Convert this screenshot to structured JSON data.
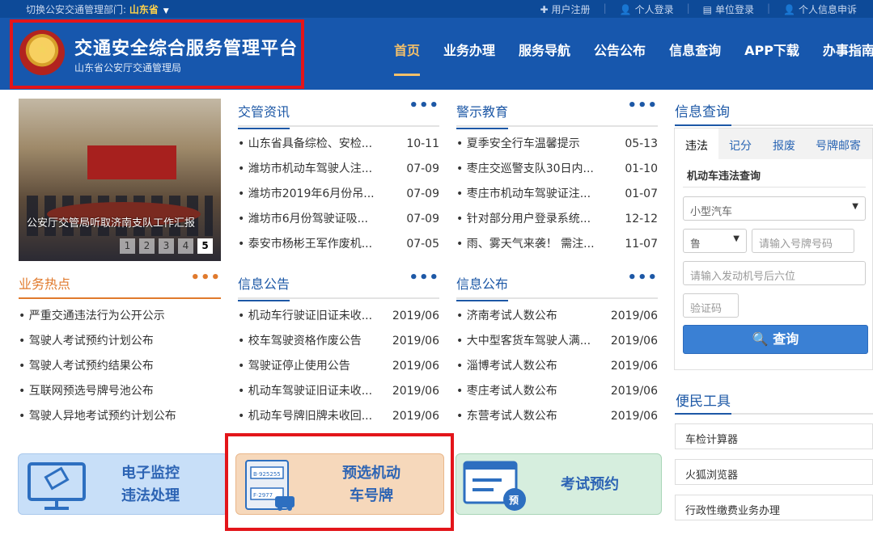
{
  "topbar": {
    "switch_label": "切换公安交通管理部门:",
    "province": "山东省",
    "links": [
      {
        "icon": "plus-icon",
        "label": "用户注册"
      },
      {
        "icon": "user-icon",
        "label": "个人登录"
      },
      {
        "icon": "building-icon",
        "label": "单位登录"
      },
      {
        "icon": "user-icon",
        "label": "个人信息申诉"
      }
    ]
  },
  "header": {
    "title": "交通安全综合服务管理平台",
    "subtitle": "山东省公安厅交通管理局",
    "nav": [
      "首页",
      "业务办理",
      "服务导航",
      "公告公布",
      "信息查询",
      "APP下载",
      "办事指南"
    ]
  },
  "slider": {
    "caption": "公安厅交管局听取济南支队工作汇报",
    "pages": [
      "1",
      "2",
      "3",
      "4",
      "5"
    ],
    "active_page": "5"
  },
  "news": {
    "title": "交管资讯",
    "more": "•••",
    "items": [
      {
        "text": "山东省具备综检、安检...",
        "date": "10-11"
      },
      {
        "text": "潍坊市机动车驾驶人注...",
        "date": "07-09"
      },
      {
        "text": "潍坊市2019年6月份吊...",
        "date": "07-09"
      },
      {
        "text": "潍坊市6月份驾驶证吸...",
        "date": "07-09"
      },
      {
        "text": "泰安市杨彬王军作废机...",
        "date": "07-05"
      }
    ]
  },
  "warning": {
    "title": "警示教育",
    "more": "•••",
    "items": [
      {
        "text": "夏季安全行车温馨提示",
        "date": "05-13"
      },
      {
        "text": "枣庄交巡警支队30日内...",
        "date": "01-10"
      },
      {
        "text": "枣庄市机动车驾驶证注...",
        "date": "01-07"
      },
      {
        "text": "针对部分用户登录系统...",
        "date": "12-12"
      },
      {
        "text": "雨、雾天气来袭！ 需注...",
        "date": "11-07"
      }
    ]
  },
  "hot": {
    "title": "业务热点",
    "more": "•••",
    "items": [
      "严重交通违法行为公开公示",
      "驾驶人考试预约计划公布",
      "驾驶人考试预约结果公布",
      "互联网预选号牌号池公布",
      "驾驶人异地考试预约计划公布"
    ]
  },
  "notice": {
    "title": "信息公告",
    "more": "•••",
    "items": [
      {
        "text": "机动车行驶证旧证未收...",
        "date": "2019/06"
      },
      {
        "text": "校车驾驶资格作废公告",
        "date": "2019/06"
      },
      {
        "text": "驾驶证停止使用公告",
        "date": "2019/06"
      },
      {
        "text": "机动车驾驶证旧证未收...",
        "date": "2019/06"
      },
      {
        "text": "机动车号牌旧牌未收回...",
        "date": "2019/06"
      }
    ]
  },
  "publish": {
    "title": "信息公布",
    "more": "•••",
    "items": [
      {
        "text": "济南考试人数公布",
        "date": "2019/06"
      },
      {
        "text": "大中型客货车驾驶人满...",
        "date": "2019/06"
      },
      {
        "text": "淄博考试人数公布",
        "date": "2019/06"
      },
      {
        "text": "枣庄考试人数公布",
        "date": "2019/06"
      },
      {
        "text": "东营考试人数公布",
        "date": "2019/06"
      }
    ]
  },
  "services": [
    {
      "icon": "monitor-icon",
      "line1": "电子监控",
      "line2": "违法处理"
    },
    {
      "icon": "license-plate-icon",
      "line1": "预选机动",
      "line2": "车号牌",
      "plate1": "B·925255",
      "plate2": "F·2977"
    },
    {
      "icon": "form-icon",
      "label": "考试预约",
      "badge": "预"
    }
  ],
  "query": {
    "title": "信息查询",
    "tabs": [
      "违法",
      "记分",
      "报废",
      "号牌邮寄"
    ],
    "active_tab": "违法",
    "subtitle": "机动车违法查询",
    "vehicle_type": "小型汽车",
    "province_prefix": "鲁",
    "plate_placeholder": "请输入号牌号码",
    "engine_placeholder": "请输入发动机号后六位",
    "captcha_placeholder": "验证码",
    "button": "查询"
  },
  "tools": {
    "title": "便民工具",
    "items": [
      "车检计算器",
      "火狐浏览器",
      "行政性缴费业务办理"
    ]
  }
}
